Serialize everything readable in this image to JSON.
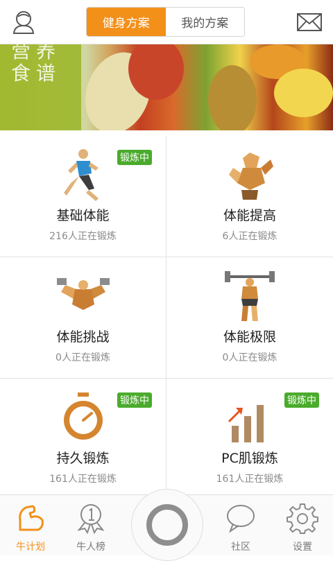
{
  "header": {
    "tab_active": "健身方案",
    "tab_inactive": "我的方案"
  },
  "banner": {
    "title": "营养食谱"
  },
  "plans": [
    {
      "name": "基础体能",
      "count": "216人正在锻炼",
      "badge": "锻炼中"
    },
    {
      "name": "体能提高",
      "count": "6人正在锻炼",
      "badge": ""
    },
    {
      "name": "体能挑战",
      "count": "0人正在锻炼",
      "badge": ""
    },
    {
      "name": "体能极限",
      "count": "0人正在锻炼",
      "badge": ""
    },
    {
      "name": "持久锻炼",
      "count": "161人正在锻炼",
      "badge": "锻炼中"
    },
    {
      "name": "PC肌锻炼",
      "count": "161人正在锻炼",
      "badge": "锻炼中"
    }
  ],
  "tabs": [
    {
      "label": "牛计划"
    },
    {
      "label": "牛人榜"
    },
    {
      "label": "社区"
    },
    {
      "label": "设置"
    }
  ],
  "colors": {
    "accent": "#f39019",
    "badge": "#4aab2c"
  }
}
